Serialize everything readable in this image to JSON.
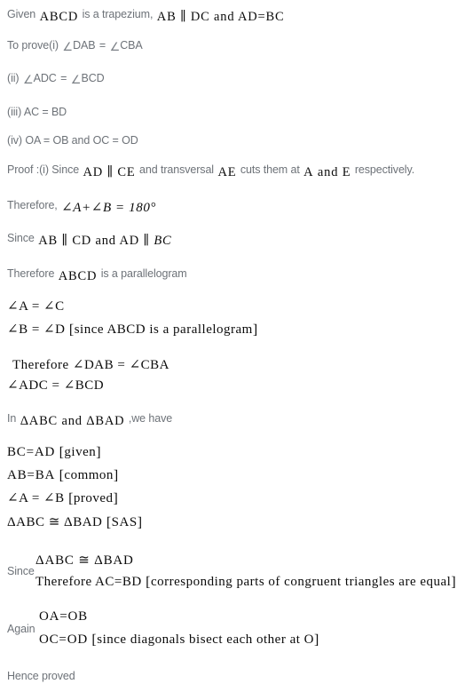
{
  "document": {
    "type": "geometry-proof",
    "subject": "Trapezium ABCD proof",
    "text_color": "#6d7278",
    "math_color": "#0b0b0b",
    "background": "#ffffff"
  },
  "lines": {
    "given": {
      "label": "Given",
      "math1": "ABCD",
      "mid": "is a trapezium,",
      "math2": "AB ∥ DC and AD=BC"
    },
    "to_prove_i": {
      "label": "To prove(i)",
      "angle1": "∠",
      "name1": "DAB",
      "eq": "=",
      "angle2": "∠",
      "name2": "CBA"
    },
    "to_prove_ii": {
      "label": "(ii)",
      "angle1": "∠",
      "name1": "ADC",
      "eq": "=",
      "angle2": "∠",
      "name2": "BCD"
    },
    "to_prove_iii": {
      "label": "(iii) AC = BD"
    },
    "to_prove_iv": {
      "label": "(iv) OA = OB and OC = OD"
    },
    "proof_i": {
      "label": "Proof :(i) Since",
      "math1": "AD ∥ CE",
      "mid1": "and transversal",
      "math2": "AE",
      "mid2": "cuts them at",
      "math3": "A",
      "mid3": "and",
      "math4": "E",
      "tail": "respectively."
    },
    "therefore_180": {
      "label": "Therefore,",
      "math": "∠A+∠B = 180°"
    },
    "since_parallel": {
      "label": "Since",
      "math_plain": "AB ∥ CD and AD ∥ ",
      "math_italic": "BC"
    },
    "therefore_pgram": {
      "label": "Therefore",
      "math": "ABCD",
      "tail": "is a parallelogram"
    },
    "angle_a_c": {
      "math": "∠A = ∠C"
    },
    "angle_b_d": {
      "math": "∠B = ∠D",
      "bracket_open": "[",
      "bracket_text": "since ABCD is a parallelogram",
      "bracket_close": "]"
    },
    "therefore_dab": {
      "math": "Therefore ∠DAB = ∠CBA"
    },
    "angle_adc_bcd": {
      "math": "∠ADC = ∠BCD"
    },
    "in_triangles": {
      "label": "In",
      "math1": "ΔABC",
      "mid": "and",
      "math2": "ΔBAD",
      "tail": ",we have"
    },
    "bc_ad": {
      "math": "BC=AD",
      "bracket_open": "[",
      "bracket_text": "given",
      "bracket_close": "]"
    },
    "ab_ba": {
      "math": "AB=BA",
      "bracket_open": "[",
      "bracket_text": "common",
      "bracket_close": "]"
    },
    "angle_a_b": {
      "math": "∠A = ∠B",
      "bracket_open": "[",
      "bracket_text": "proved",
      "bracket_close": "]"
    },
    "congruent_sas": {
      "math": "ΔABC ≅ ΔBAD",
      "bracket_open": "[",
      "bracket_text": "SAS",
      "bracket_close": "]"
    },
    "since_congruent": {
      "label": "Since",
      "math_top": "ΔABC ≅ ΔBAD",
      "math_bottom": "Therefore AC=BD",
      "bracket_open": "[",
      "bracket_text": "corresponding parts of congruent triangles are equal",
      "bracket_close": "]"
    },
    "again_block": {
      "label": "Again",
      "math_top": "OA=OB",
      "math_bottom": "OC=OD",
      "bracket_open": "[",
      "bracket_text": "since diagonals bisect each other at O",
      "bracket_close": "]"
    },
    "hence_proved": {
      "label": "Hence proved"
    }
  }
}
